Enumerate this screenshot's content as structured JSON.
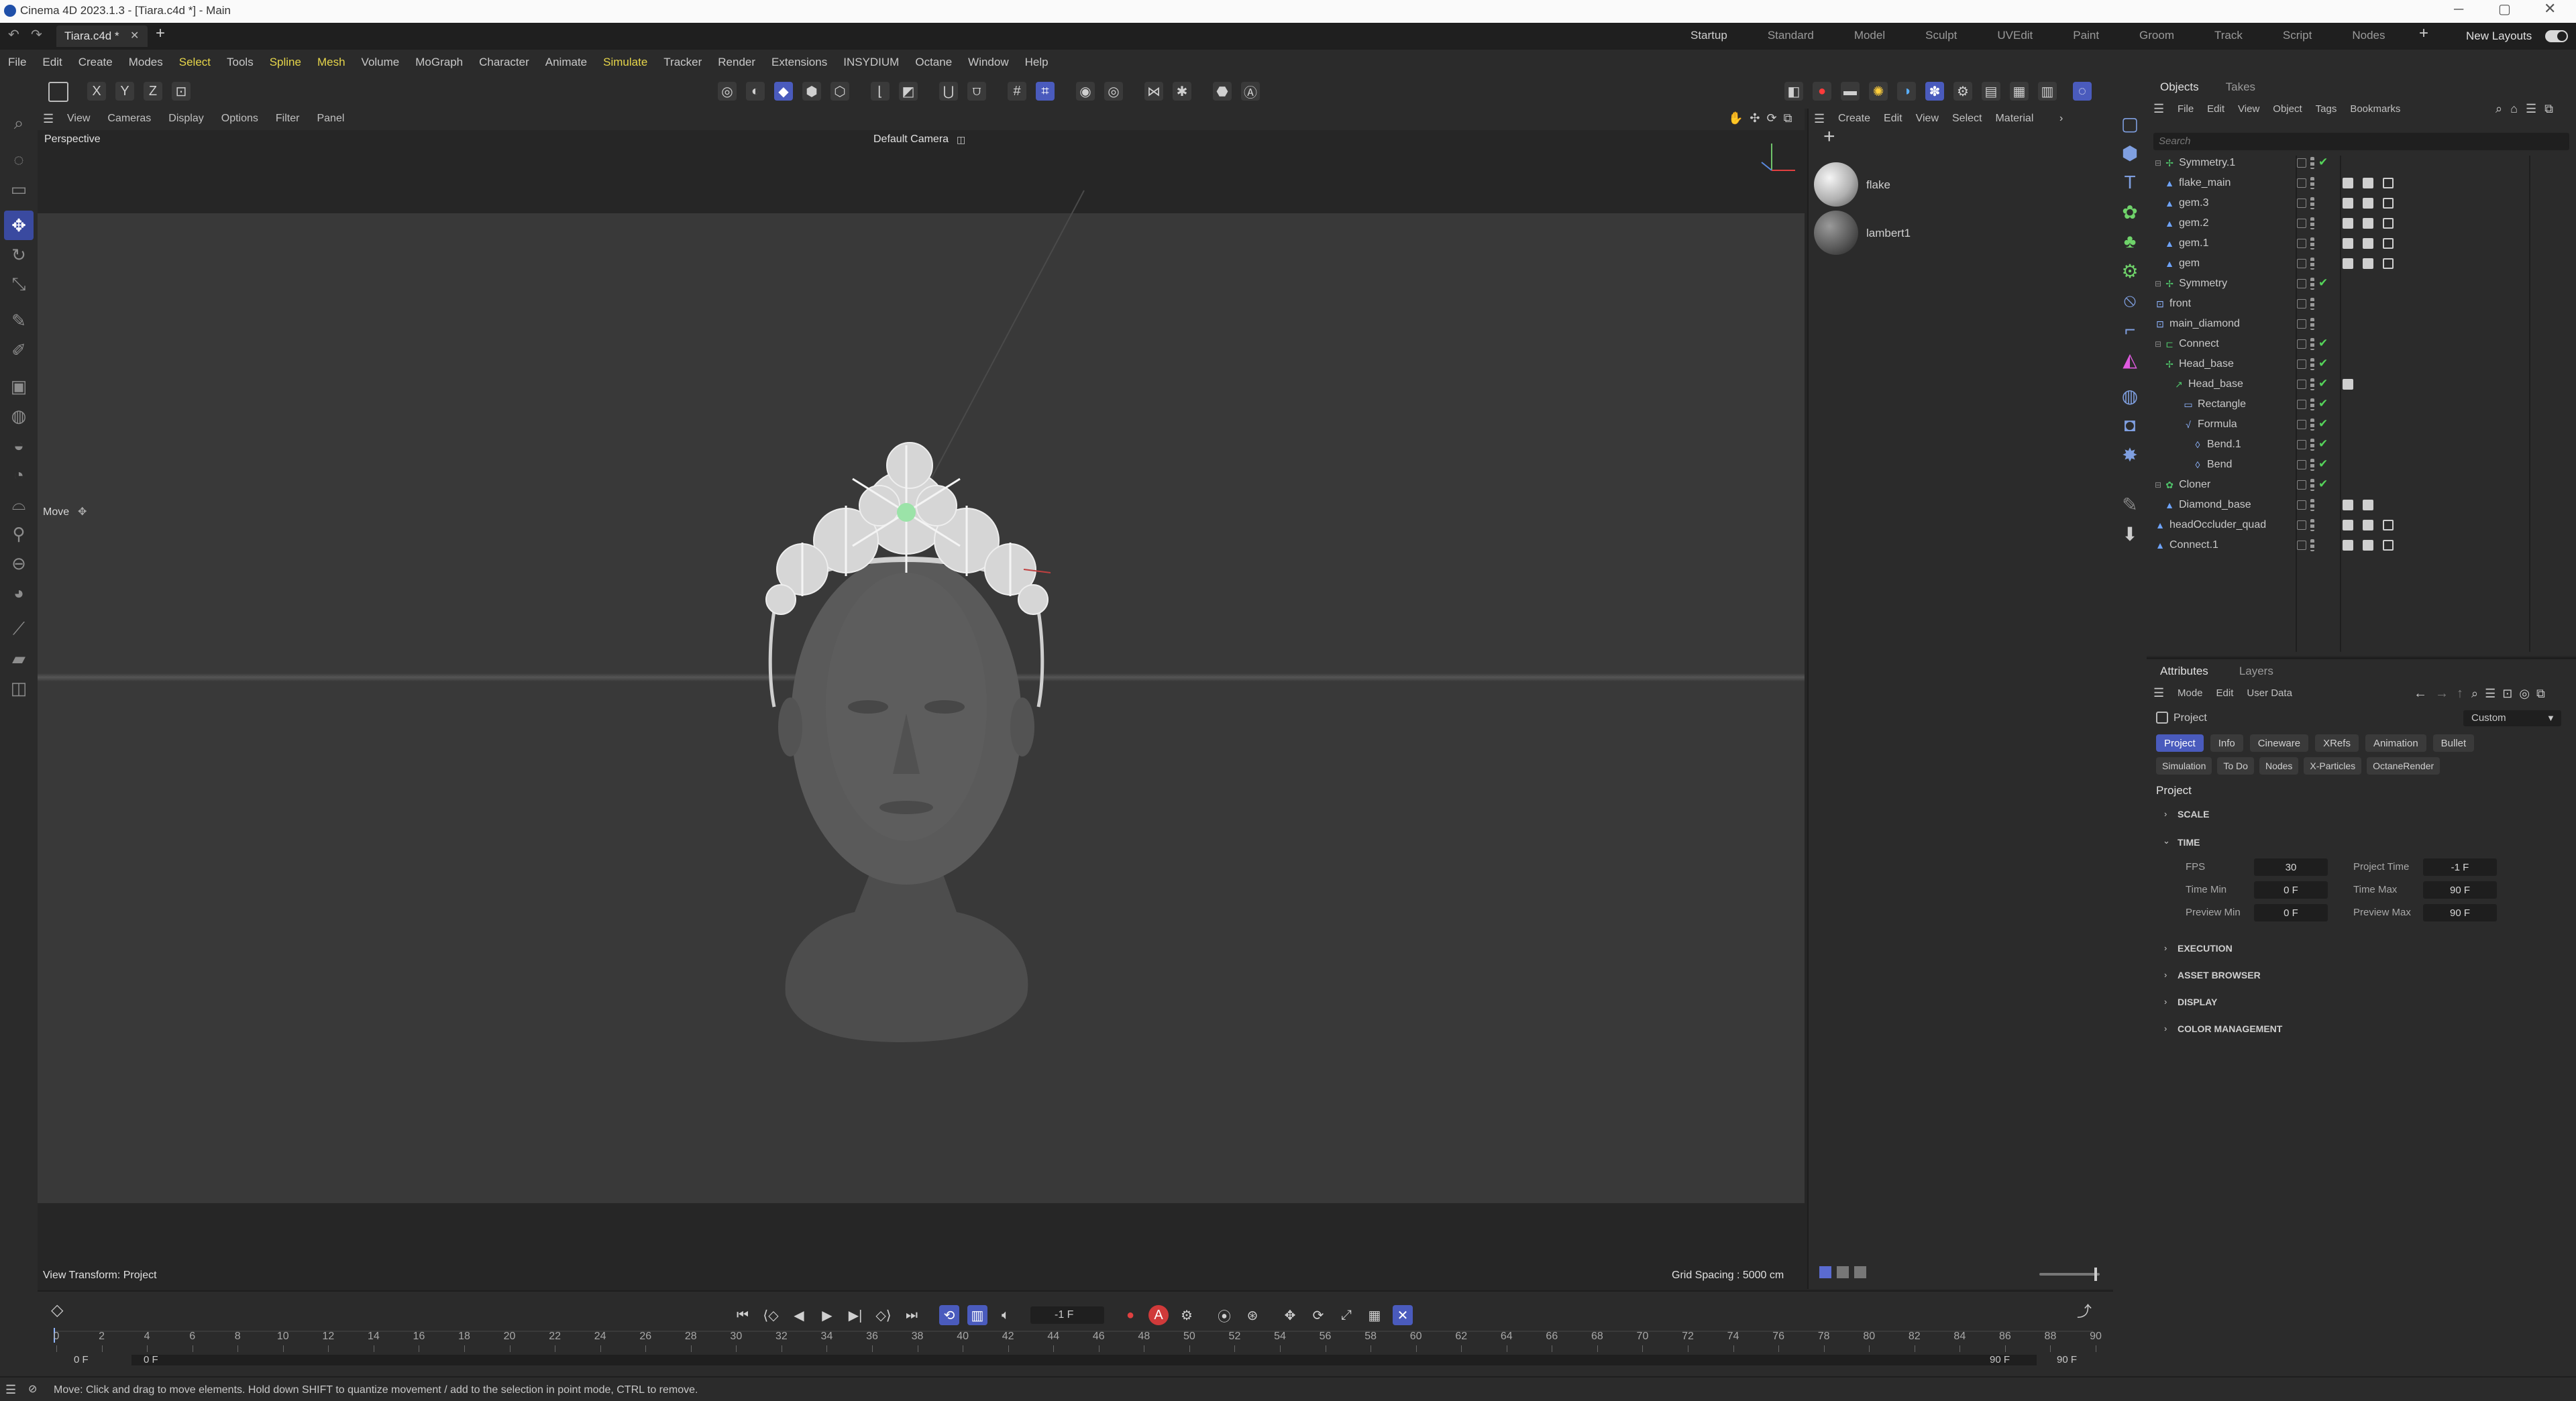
{
  "titlebar": {
    "title": "Cinema 4D 2023.1.3 - [Tiara.c4d *] - Main"
  },
  "doc_tab": {
    "name": "Tiara.c4d *"
  },
  "layouts": [
    "Startup",
    "Standard",
    "Model",
    "Sculpt",
    "UVEdit",
    "Paint",
    "Groom",
    "Track",
    "Script",
    "Nodes"
  ],
  "new_layouts": "New Layouts",
  "menu": [
    "File",
    "Edit",
    "Create",
    "Modes",
    "Select",
    "Tools",
    "Spline",
    "Mesh",
    "Volume",
    "MoGraph",
    "Character",
    "Animate",
    "Simulate",
    "Tracker",
    "Render",
    "Extensions",
    "INSYDIUM",
    "Octane",
    "Window",
    "Help"
  ],
  "menu_highlight": [
    "Select",
    "Spline",
    "Mesh",
    "Simulate"
  ],
  "viewport": {
    "menu": [
      "View",
      "Cameras",
      "Display",
      "Options",
      "Filter",
      "Panel"
    ],
    "label": "Perspective",
    "camera": "Default Camera",
    "tool": "Move",
    "view_transform": "View Transform: Project",
    "grid_spacing": "Grid Spacing : 5000 cm"
  },
  "material_manager": {
    "menu": [
      "Create",
      "Edit",
      "View",
      "Select",
      "Material"
    ],
    "materials": [
      "flake",
      "lambert1"
    ]
  },
  "objects_panel": {
    "tabs": [
      "Objects",
      "Takes"
    ],
    "menu": [
      "File",
      "Edit",
      "View",
      "Object",
      "Tags",
      "Bookmarks"
    ],
    "search_placeholder": "Search",
    "items": [
      {
        "name": "Symmetry.1",
        "depth": 0,
        "icon": "symmetry-icon",
        "color": "#4fc36a"
      },
      {
        "name": "flake_main",
        "depth": 1,
        "icon": "polygon-icon",
        "color": "#6ea4ff"
      },
      {
        "name": "gem.3",
        "depth": 1,
        "icon": "polygon-icon",
        "color": "#6ea4ff"
      },
      {
        "name": "gem.2",
        "depth": 1,
        "icon": "polygon-icon",
        "color": "#6ea4ff"
      },
      {
        "name": "gem.1",
        "depth": 1,
        "icon": "polygon-icon",
        "color": "#6ea4ff"
      },
      {
        "name": "gem",
        "depth": 1,
        "icon": "polygon-icon",
        "color": "#6ea4ff"
      },
      {
        "name": "Symmetry",
        "depth": 0,
        "icon": "symmetry-icon",
        "color": "#4fc36a"
      },
      {
        "name": "front",
        "depth": 0,
        "icon": "null-icon",
        "color": "#8fb5ff"
      },
      {
        "name": "main_diamond",
        "depth": 0,
        "icon": "null-icon",
        "color": "#8fb5ff"
      },
      {
        "name": "Connect",
        "depth": 0,
        "icon": "connect-icon",
        "color": "#4fc36a"
      },
      {
        "name": "Head_base",
        "depth": 1,
        "icon": "symmetry-icon",
        "color": "#4fc36a"
      },
      {
        "name": "Head_base",
        "depth": 2,
        "icon": "sweep-icon",
        "color": "#4fc36a"
      },
      {
        "name": "Rectangle",
        "depth": 3,
        "icon": "spline-icon",
        "color": "#8fb5ff"
      },
      {
        "name": "Formula",
        "depth": 3,
        "icon": "formula-icon",
        "color": "#8fb5ff"
      },
      {
        "name": "Bend.1",
        "depth": 4,
        "icon": "bend-icon",
        "color": "#8fb5ff"
      },
      {
        "name": "Bend",
        "depth": 4,
        "icon": "bend-icon",
        "color": "#8fb5ff"
      },
      {
        "name": "Cloner",
        "depth": 0,
        "icon": "cloner-icon",
        "color": "#4fc36a"
      },
      {
        "name": "Diamond_base",
        "depth": 1,
        "icon": "polygon-icon",
        "color": "#6ea4ff"
      },
      {
        "name": "headOccluder_quad",
        "depth": 0,
        "icon": "polygon-icon",
        "color": "#6ea4ff"
      },
      {
        "name": "Connect.1",
        "depth": 0,
        "icon": "polygon-icon",
        "color": "#6ea4ff"
      }
    ]
  },
  "attributes": {
    "tabs": [
      "Attributes",
      "Layers"
    ],
    "menu": [
      "Mode",
      "Edit",
      "User Data"
    ],
    "object": "Project",
    "preset": "Custom",
    "tab_row1": [
      "Project",
      "Info",
      "Cineware",
      "XRefs",
      "Animation",
      "Bullet"
    ],
    "tab_row2": [
      "Simulation",
      "To Do",
      "Nodes",
      "X-Particles",
      "OctaneRender"
    ],
    "active_tab": "Project",
    "section_title": "Project",
    "sections": {
      "scale": "SCALE",
      "time": "TIME",
      "execution": "EXECUTION",
      "asset_browser": "ASSET BROWSER",
      "display": "DISPLAY",
      "color_management": "COLOR MANAGEMENT"
    },
    "time": {
      "fps_label": "FPS",
      "fps": "30",
      "project_time_label": "Project Time",
      "project_time": "-1 F",
      "time_min_label": "Time Min",
      "time_min": "0 F",
      "time_max_label": "Time Max",
      "time_max": "90 F",
      "preview_min_label": "Preview Min",
      "preview_min": "0 F",
      "preview_max_label": "Preview Max",
      "preview_max": "90 F"
    }
  },
  "timeline": {
    "current_frame": "-1 F",
    "ticks": [
      "0",
      "2",
      "4",
      "6",
      "8",
      "10",
      "12",
      "14",
      "16",
      "18",
      "20",
      "22",
      "24",
      "26",
      "28",
      "30",
      "32",
      "34",
      "36",
      "38",
      "40",
      "42",
      "44",
      "46",
      "48",
      "50",
      "52",
      "54",
      "56",
      "58",
      "60",
      "62",
      "64",
      "66",
      "68",
      "70",
      "72",
      "74",
      "76",
      "78",
      "80",
      "82",
      "84",
      "86",
      "88",
      "90"
    ],
    "start": "0 F",
    "start2": "0 F",
    "end": "90 F",
    "end2": "90 F"
  },
  "status": "Move: Click and drag to move elements. Hold down SHIFT to quantize movement / add to the selection in point mode, CTRL to remove."
}
